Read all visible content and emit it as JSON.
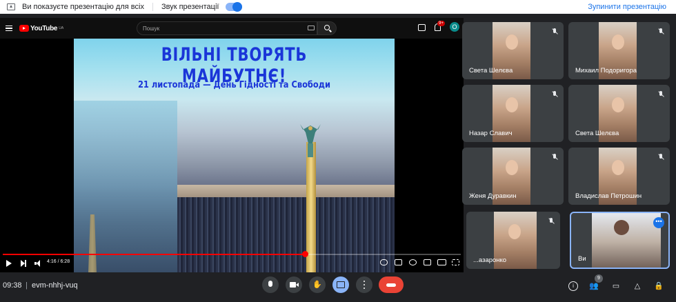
{
  "presenting_bar": {
    "status_text": "Ви показуєте презентацію для всіх",
    "sound_label": "Звук презентації",
    "sound_on": true,
    "stop_label": "Зупинити презентацію"
  },
  "youtube": {
    "logo_text": "YouTube",
    "region": "UA",
    "search_placeholder": "Пошук",
    "notifications_badge": "9+",
    "avatar_letter": "О"
  },
  "slide": {
    "title": "ВІЛЬНІ ТВОРЯТЬ МАЙБУТНЄ!",
    "subtitle": "21 листопада — День Гідності та Свободи"
  },
  "player": {
    "time": "4:16 / 6:28",
    "progress": 0.66
  },
  "participants": [
    {
      "name": "Света Шелєва"
    },
    {
      "name": "Михаил Подоригора"
    },
    {
      "name": "Назар Славич"
    },
    {
      "name": "Света Шелєва"
    },
    {
      "name": "Женя Дуравкин"
    },
    {
      "name": "Владислав Петрошин"
    },
    {
      "name": "...азаронко"
    },
    {
      "name": "Ви"
    }
  ],
  "bottom": {
    "time": "09:38",
    "separator": "|",
    "meeting_code": "evm-nhhj-vuq",
    "people_count": "9"
  }
}
